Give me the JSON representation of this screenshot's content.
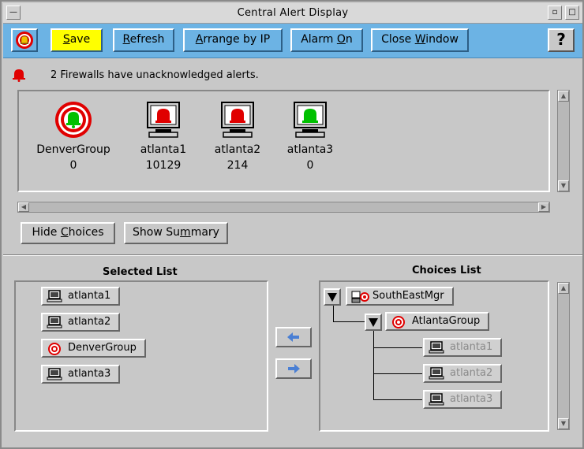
{
  "window": {
    "title": "Central Alert Display"
  },
  "toolbar": {
    "save_pre": "",
    "save_ul": "S",
    "save_post": "ave",
    "refresh_pre": "",
    "refresh_ul": "R",
    "refresh_post": "efresh",
    "arrange_pre": "",
    "arrange_ul": "A",
    "arrange_post": "rrange by IP",
    "alarm_pre": "Alarm ",
    "alarm_ul": "O",
    "alarm_post": "n",
    "close_pre": "Close ",
    "close_ul": "W",
    "close_post": "indow",
    "help_label": "?"
  },
  "status": {
    "message": "2 Firewalls have unacknowledged alerts.",
    "bell_color": "#e00000"
  },
  "nodes": [
    {
      "name": "DenverGroup",
      "count": "0",
      "type": "group",
      "alert": "#00c000"
    },
    {
      "name": "atlanta1",
      "count": "10129",
      "type": "host",
      "alert": "#e00000"
    },
    {
      "name": "atlanta2",
      "count": "214",
      "type": "host",
      "alert": "#e00000"
    },
    {
      "name": "atlanta3",
      "count": "0",
      "type": "host",
      "alert": "#00c000"
    }
  ],
  "buttons": {
    "hide_pre": "Hide ",
    "hide_ul": "C",
    "hide_post": "hoices",
    "summary_pre": "Show Su",
    "summary_ul": "m",
    "summary_post": "mary"
  },
  "selected_list": {
    "heading": "Selected List",
    "items": [
      "atlanta1",
      "atlanta2",
      "DenverGroup",
      "atlanta3"
    ]
  },
  "choices_list": {
    "heading": "Choices List",
    "root": "SouthEastMgr",
    "group": "AtlantaGroup",
    "hosts": [
      "atlanta1",
      "atlanta2",
      "atlanta3"
    ]
  },
  "colors": {
    "toolbar": "#6cb3e4",
    "save_highlight": "#ffff00",
    "alert_red": "#e00000",
    "ok_green": "#00c000",
    "move_arrow": "#4a7fd4"
  }
}
